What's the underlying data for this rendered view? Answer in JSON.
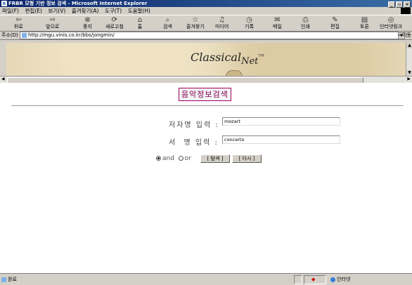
{
  "window": {
    "title": "FRBR 모형 기반 정보 검색 - Microsoft Internet Explorer",
    "controls": [
      "_",
      "▫",
      "×"
    ]
  },
  "menu": [
    "파일(F)",
    "편집(E)",
    "보기(V)",
    "즐겨찾기(A)",
    "도구(T)",
    "도움말(H)"
  ],
  "toolbar": {
    "back": "뒤로",
    "forward": "앞으로",
    "stop": "중지",
    "refresh": "새로고침",
    "home": "홈",
    "search": "검색",
    "favorites": "즐겨찾기",
    "media": "미디어",
    "history": "기록",
    "mail": "메일",
    "print": "인쇄",
    "edit": "편집",
    "discuss": "토론",
    "links": "인터넷링크"
  },
  "address": {
    "label": "주소(D)",
    "url": "http://mgu.vinis.co.kr/bbs/jongmin/",
    "go": "이동"
  },
  "banner": {
    "brand": "Classical",
    "brand_suffix": "Net",
    "trademark": "TM"
  },
  "form": {
    "page_title": "음악정보검색",
    "author_label": "저자명 입력 :",
    "author_value": "mozart",
    "title_label": "서  명 입력 :",
    "title_value": "concerto",
    "and_label": "and",
    "or_label": "or",
    "search_button": "[ 탐색 ]",
    "reset_button": "[ 다시 ]",
    "selected_operator": "and"
  },
  "status": {
    "text": "완료",
    "zone": "인터넷"
  },
  "colors": {
    "title_text": "#8b0057",
    "banner_bg": "#e6d9b8"
  }
}
